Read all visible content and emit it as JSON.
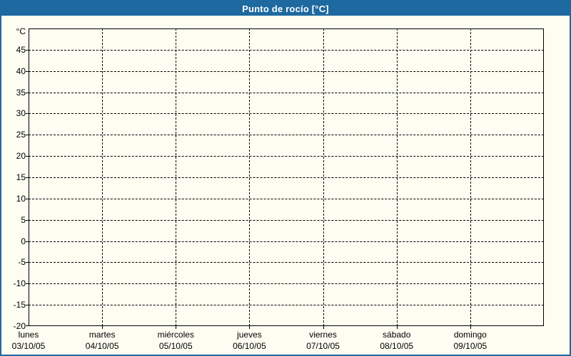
{
  "window": {
    "title": "Punto de rocío [°C]"
  },
  "colors": {
    "titlebar_bg": "#1e69a0",
    "frame_border": "#1e69a0",
    "title_text": "#ffffff",
    "background": "#fdfdf2",
    "axis": "#000000",
    "grid": "#000000",
    "label_text": "#000000"
  },
  "chart_data": {
    "type": "line",
    "title": "Punto de rocío [°C]",
    "y_unit_label": "°C",
    "ylim": [
      -20,
      50
    ],
    "ytick_step": 5,
    "yticks": [
      45,
      40,
      35,
      30,
      25,
      20,
      15,
      10,
      5,
      0,
      -5,
      -10,
      -15,
      -20
    ],
    "x_categories": [
      {
        "day": "lunes",
        "date": "03/10/05"
      },
      {
        "day": "martes",
        "date": "04/10/05"
      },
      {
        "day": "miércoles",
        "date": "05/10/05"
      },
      {
        "day": "jueves",
        "date": "06/10/05"
      },
      {
        "day": "viernes",
        "date": "07/10/05"
      },
      {
        "day": "sábado",
        "date": "08/10/05"
      },
      {
        "day": "domingo",
        "date": "09/10/05"
      }
    ],
    "series": [],
    "grid": "dashed",
    "legend": "none"
  }
}
